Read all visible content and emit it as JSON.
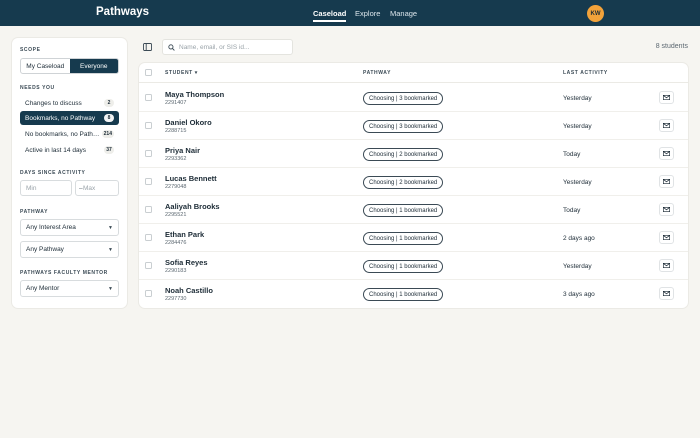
{
  "app": {
    "brand": "Pathways",
    "avatar_initials": "KW"
  },
  "nav": [
    {
      "label": "Caseload",
      "active": true
    },
    {
      "label": "Explore",
      "active": false
    },
    {
      "label": "Manage",
      "active": false
    }
  ],
  "sidebar": {
    "scope_label": "SCOPE",
    "scope_options": [
      "My Caseload",
      "Everyone"
    ],
    "scope_selected": "Everyone",
    "needs_label": "NEEDS YOU",
    "needs": [
      {
        "label": "Changes to discuss",
        "count": "2",
        "selected": false
      },
      {
        "label": "Bookmarks, no Pathway",
        "count": "8",
        "selected": true
      },
      {
        "label": "No bookmarks, no Path…",
        "count": "214",
        "selected": false
      },
      {
        "label": "Active in last 14 days",
        "count": "37",
        "selected": false
      }
    ],
    "days_label": "DAYS SINCE ACTIVITY",
    "days_min_placeholder": "Min",
    "days_max_placeholder": "Max",
    "days_separator": "–",
    "pathway_label": "PATHWAY",
    "interest_area": "Any Interest Area",
    "pathway": "Any Pathway",
    "mentor_label": "PATHWAYS FACULTY MENTOR",
    "mentor": "Any Mentor"
  },
  "main": {
    "search_placeholder": "Name, email, or SIS id...",
    "student_count": "8 students",
    "columns": {
      "student": "STUDENT ▾",
      "pathway": "PATHWAY",
      "last_activity": "LAST ACTIVITY"
    },
    "rows": [
      {
        "name": "Maya Thompson",
        "id": "2291407",
        "pathway": "Choosing | 3 bookmarked",
        "last_activity": "Yesterday"
      },
      {
        "name": "Daniel Okoro",
        "id": "2288715",
        "pathway": "Choosing | 3 bookmarked",
        "last_activity": "Yesterday"
      },
      {
        "name": "Priya Nair",
        "id": "2293362",
        "pathway": "Choosing | 2 bookmarked",
        "last_activity": "Today"
      },
      {
        "name": "Lucas Bennett",
        "id": "2279048",
        "pathway": "Choosing | 2 bookmarked",
        "last_activity": "Yesterday"
      },
      {
        "name": "Aaliyah Brooks",
        "id": "2295521",
        "pathway": "Choosing | 1 bookmarked",
        "last_activity": "Today"
      },
      {
        "name": "Ethan Park",
        "id": "2284476",
        "pathway": "Choosing | 1 bookmarked",
        "last_activity": "2 days ago"
      },
      {
        "name": "Sofia Reyes",
        "id": "2290183",
        "pathway": "Choosing | 1 bookmarked",
        "last_activity": "Yesterday"
      },
      {
        "name": "Noah Castillo",
        "id": "2297730",
        "pathway": "Choosing | 1 bookmarked",
        "last_activity": "3 days ago"
      }
    ]
  },
  "colors": {
    "topbar": "#163a4e",
    "accent": "#163a4e",
    "avatar": "#f2a23a",
    "background": "#f6f5f1"
  },
  "icons": [
    "search-icon",
    "sidebar-toggle-icon",
    "mail-icon",
    "chevron-down-icon"
  ]
}
